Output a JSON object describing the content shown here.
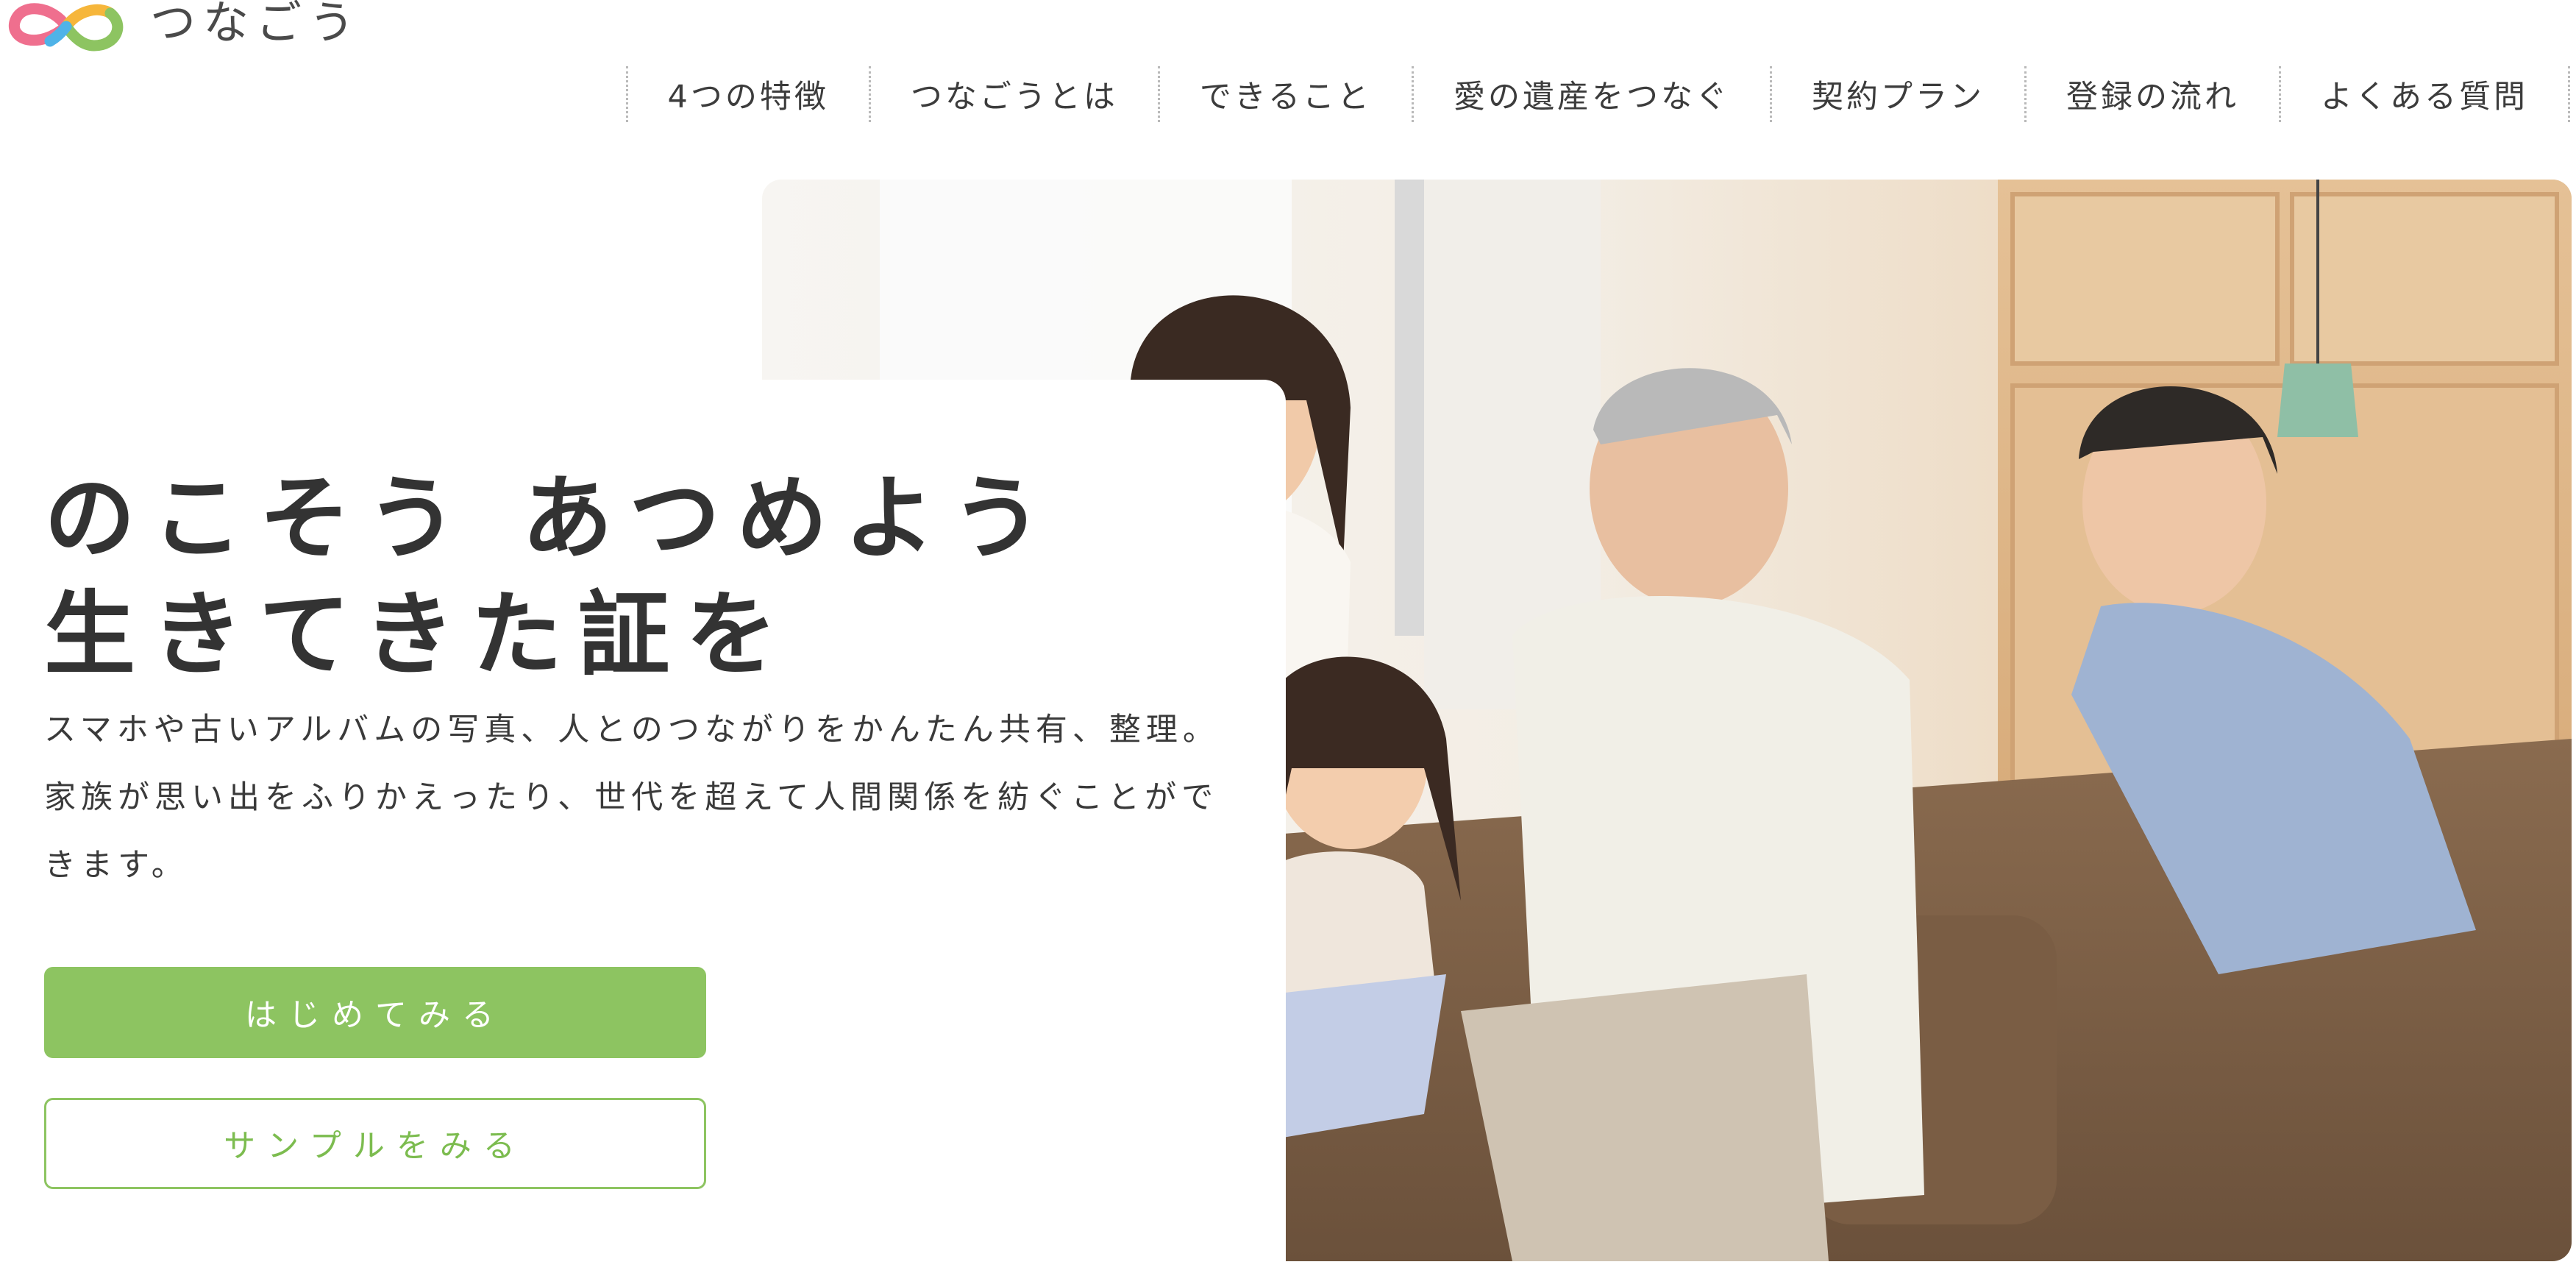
{
  "header": {
    "logo_text": "つなごう",
    "logo_colors": [
      "#ef6f8e",
      "#f6b63b",
      "#8dc461",
      "#4fb3e8"
    ]
  },
  "nav": {
    "items": [
      {
        "label": "4つの特徴"
      },
      {
        "label": "つなごうとは"
      },
      {
        "label": "できること"
      },
      {
        "label": "愛の遺産をつなぐ"
      },
      {
        "label": "契約プラン"
      },
      {
        "label": "登録の流れ"
      },
      {
        "label": "よくある質問"
      }
    ]
  },
  "hero": {
    "catch_line1": "のこそう あつめよう",
    "catch_line2": "生きてきた証を",
    "lead": "スマホや古いアルバムの写真、人とのつながりをかんたん共有、整理。家族が思い出をふりかえったり、世代を超えて人間関係を紡ぐことができます。",
    "primary_button": "はじめてみる",
    "secondary_button": "サンプルをみる",
    "accent_color": "#8dc461"
  }
}
